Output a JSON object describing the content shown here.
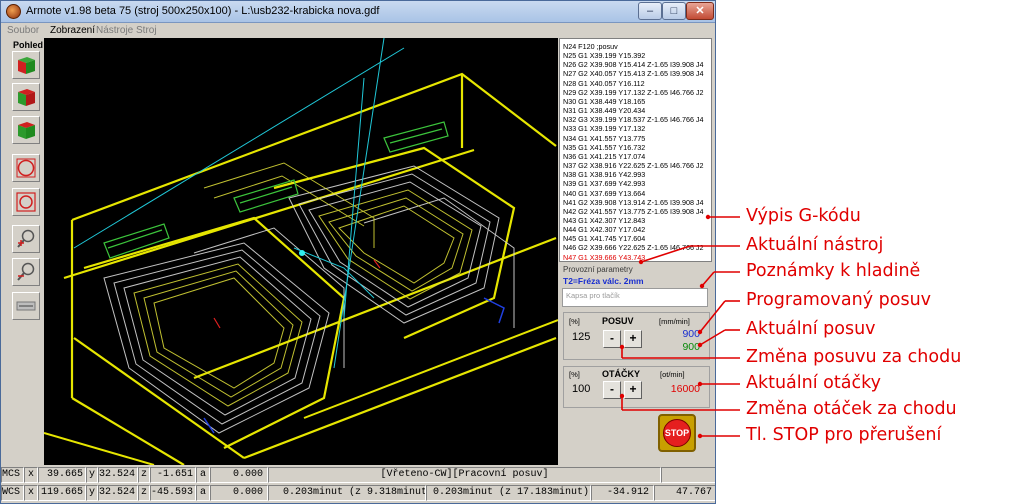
{
  "window": {
    "title": "Armote v1.98 beta 75 (stroj 500x250x100) - L:\\usb232-krabicka nova.gdf",
    "controls": {
      "minimize": "–",
      "maximize": "□",
      "close": "✕"
    }
  },
  "menu": [
    {
      "label": "Soubor",
      "enabled": false
    },
    {
      "label": "Zobrazení",
      "enabled": true
    },
    {
      "label": "Nástroje",
      "enabled": false
    },
    {
      "label": "Stroj",
      "enabled": false
    }
  ],
  "toolbar": {
    "view_label": "Pohled",
    "buttons": [
      "cube-front-icon",
      "cube-side-icon",
      "cube-top-icon",
      "fit-circle-icon",
      "fit-square-icon",
      "zoom-in-icon",
      "zoom-out-icon",
      "path-toggle-icon"
    ]
  },
  "gcode": {
    "lines": [
      "N24 F120 ;posuv",
      "N25 G1 X39.199 Y15.392",
      "N26 G2 X39.908 Y15.414 Z-1.65 I39.908 J4",
      "N27 G2 X40.057 Y15.413 Z-1.65 I39.908 J4",
      "N28 G1 X40.057 Y16.112",
      "N29 G2 X39.199 Y17.132 Z-1.65 I46.766 J2",
      "N30 G1 X38.449 Y18.165",
      "N31 G1 X38.449 Y20.434",
      "N32 G3 X39.199 Y18.537 Z-1.65 I46.766 J4",
      "N33 G1 X39.199 Y17.132",
      "N34 G1 X41.557 Y13.775",
      "N35 G1 X41.557 Y16.732",
      "N36 G1 X41.215 Y17.074",
      "N37 G2 X38.916 Y22.625 Z-1.65 I46.766 J2",
      "N38 G1 X38.916 Y42.993",
      "N39 G1 X37.699 Y42.993",
      "N40 G1 X37.699 Y13.664",
      "N41 G2 X39.908 Y13.914 Z-1.65 I39.908 J4",
      "N42 G2 X41.557 Y13.775 Z-1.65 I39.908 J4",
      "N43 G1 X42.307 Y12.843",
      "N44 G1 X42.307 Y17.042",
      "N45 G1 X41.745 Y17.604",
      "N46 G2 X39.666 Y22.625 Z-1.65 I46.766 J2",
      "N47 G1 X39.666 Y43.743"
    ],
    "current_index": 23
  },
  "params": {
    "caption": "Provozní parametry",
    "tool": "T2=Fréza válc. 2mm",
    "note_placeholder": "Kapsa pro tlačík"
  },
  "feed": {
    "pct_unit": "[%]",
    "label": "POSUV",
    "unit": "[mm/min]",
    "override_pct": "125",
    "minus": "-",
    "plus": "+",
    "programmed": "900",
    "actual": "900",
    "programmed_color": "#1a2fd0",
    "actual_color": "#0a8a0a"
  },
  "spindle": {
    "pct_unit": "[%]",
    "label": "OTÁČKY",
    "unit": "[ot/min]",
    "override_pct": "100",
    "minus": "-",
    "plus": "+",
    "actual": "16000",
    "actual_color": "#e00000"
  },
  "stop": {
    "label": "STOP"
  },
  "status": {
    "mcs": {
      "system": "MCS",
      "x_label": "x",
      "x": "39.665",
      "y_label": "y",
      "y": "32.524",
      "z_label": "z",
      "z": "-1.651",
      "a_label": "a",
      "a": "0.000",
      "message": "[Vřeteno-CW][Pracovní posuv]"
    },
    "wcs": {
      "system": "WCS",
      "x_label": "x",
      "x": "119.665",
      "y_label": "y",
      "y": "32.524",
      "z_label": "z",
      "z": "-45.593",
      "a_label": "a",
      "a": "0.000",
      "elapsed": "0.203minut (z 9.318minut)",
      "remaining": "0.203minut (z 17.183minut)",
      "value1": "-34.912",
      "value2": "47.767"
    }
  },
  "annotations": [
    "Výpis G-kódu",
    "Aktuální nástroj",
    "Poznámky k hladině",
    "Programovaný posuv",
    "Aktuální posuv",
    "Změna posuvu za chodu",
    "Aktuální otáčky",
    "Změna otáček za chodu",
    "Tl. STOP pro přerušení"
  ],
  "annotation_color": "#e00000"
}
